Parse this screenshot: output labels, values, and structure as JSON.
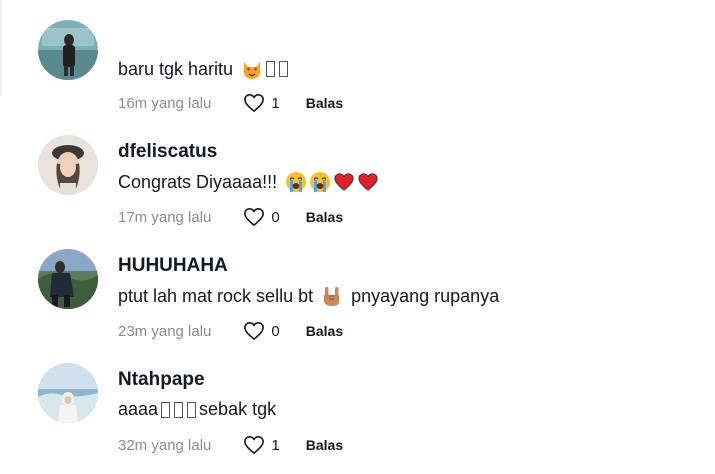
{
  "comments": [
    {
      "username": "",
      "text": "baru tgk haritu",
      "time": "16m yang lalu",
      "likes": "1",
      "reply_label": "Balas"
    },
    {
      "username": "dfeliscatus",
      "text": "Congrats Diyaaaa!!!",
      "time": "17m yang lalu",
      "likes": "0",
      "reply_label": "Balas"
    },
    {
      "username": "HUHUHAHA",
      "text_before": "ptut lah mat rock sellu bt",
      "text_after": "pnyayang rupanya",
      "time": "23m yang lalu",
      "likes": "0",
      "reply_label": "Balas"
    },
    {
      "username": "Ntahpape",
      "text_before": "aaaa",
      "text_after": "sebak tgk",
      "time": "32m yang lalu",
      "likes": "1",
      "reply_label": "Balas"
    }
  ],
  "icons": {
    "like": "heart-outline-icon",
    "emoji_1": "heart-eyes-cat-emoji",
    "emoji_2": "crying-face-emoji",
    "emoji_3": "red-heart-emoji",
    "emoji_4": "rock-on-hand-emoji"
  }
}
